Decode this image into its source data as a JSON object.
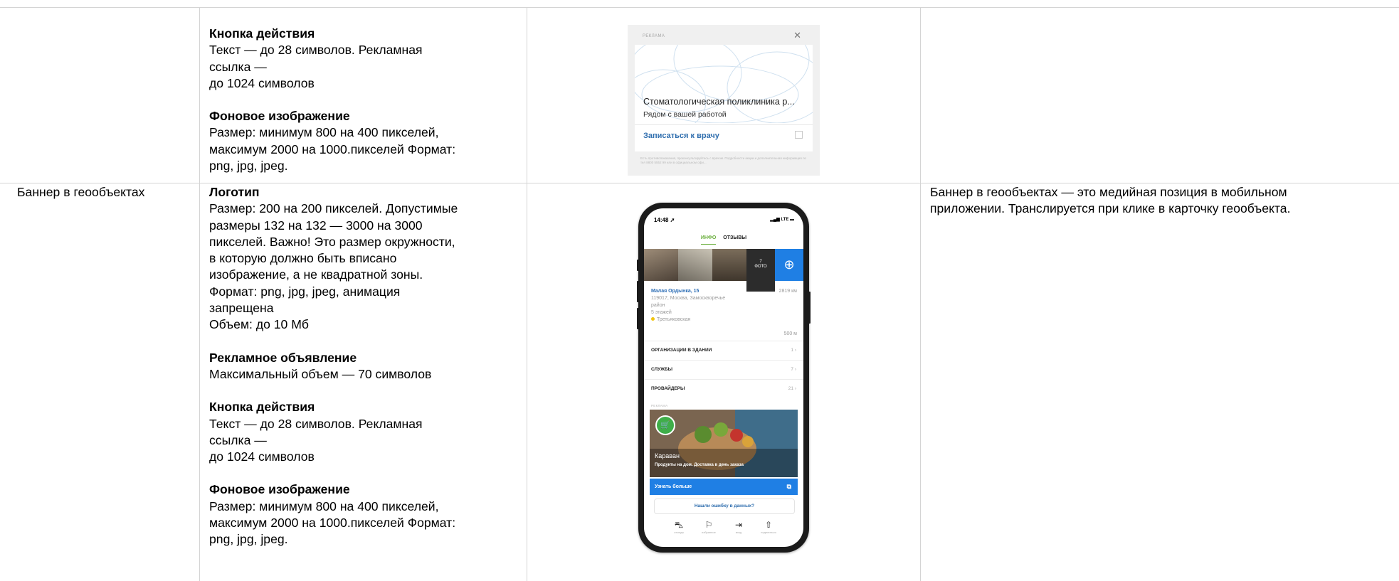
{
  "rows": [
    {
      "name": "",
      "sections": [
        {
          "title": "Кнопка действия",
          "text": "Текст — до 28 символов. Рекламная\nссылка —\nдо 1024 символов"
        },
        {
          "title": "Фоновое изображение",
          "text": "Размер: минимум 800 на 400 пикселей,\nмаксимум 2000 на 1000.пикселей Формат:\npng, jpg, jpeg."
        }
      ],
      "description": ""
    },
    {
      "name": "Баннер в геообъектах",
      "sections": [
        {
          "title": "Логотип",
          "text": "Размер: 200 на 200 пикселей. Допустимые\nразмеры 132 на 132 — 3000 на 3000\nпикселей. Важно! Это размер окружности,\nв которую должно быть вписано\nизображение, а не квадратной зоны.\nФормат: png, jpg, jpeg, анимация\nзапрещена\nОбъем: до 10 Мб"
        },
        {
          "title": "Рекламное объявление",
          "text": "Максимальный объем — 70 символов"
        },
        {
          "title": "Кнопка действия",
          "text": "Текст — до 28 символов. Рекламная\nссылка —\nдо 1024 символов"
        },
        {
          "title": "Фоновое изображение",
          "text": "Размер: минимум 800 на 400 пикселей,\nмаксимум 2000 на 1000.пикселей Формат:\npng, jpg, jpeg."
        }
      ],
      "description": "Баннер в геообъектах — это медийная позиция в мобильном\nприложении. Транслируется при клике в карточку геообъекта."
    }
  ],
  "ad_preview": {
    "label": "РЕКЛАМА",
    "close_icon": "close-icon",
    "title": "Стоматологическая поликлиника р...",
    "subtitle": "Рядом с вашей работой",
    "cta": "Записаться к врачу",
    "disclaimer": "Есть противопоказания, проконсультируйтесь с врачом. Подробности акции и дополнительная информация по тел 8800 5552 99 или в официальном офи..."
  },
  "phone": {
    "time": "14:48 ➚",
    "status": "LTE",
    "tab_info": "ИНФО",
    "tab_reviews": "ОТЗЫВЫ",
    "photo_count": "7\nФОТО",
    "camera_icon": "camera-add-icon",
    "address_title": "Малая Ордынка, 15",
    "address_distance": "2819 км",
    "address_lines": "119017, Москва, Замоскворечье\nрайон\n5 этажей",
    "metro": "Третьяковская",
    "metro_distance": "500 м",
    "list": [
      {
        "label": "ОРГАНИЗАЦИИ В ЗДАНИИ",
        "count": "1 ›"
      },
      {
        "label": "СЛУЖБЫ",
        "count": "7 ›"
      },
      {
        "label": "ПРОВАЙДЕРЫ",
        "count": "21 ›"
      }
    ],
    "promo_label": "РЕКЛАМА",
    "promo_title": "Караван",
    "promo_subtitle": "Продукты на дом. Доставка в день заказа",
    "promo_cta": "Узнать больше",
    "report": "Нашли ошибку в данных?",
    "toolbar": [
      {
        "icon": "route-icon",
        "label": "отсюда"
      },
      {
        "icon": "bookmark-icon",
        "label": "избранное"
      },
      {
        "icon": "entrance-icon",
        "label": "вход"
      },
      {
        "icon": "share-icon",
        "label": "поделиться"
      }
    ]
  },
  "colors": {
    "grid": "#d4d4d4",
    "link_blue": "#2f6eae",
    "accent_green": "#6aaf3d",
    "cta_blue": "#1f7fe4"
  }
}
